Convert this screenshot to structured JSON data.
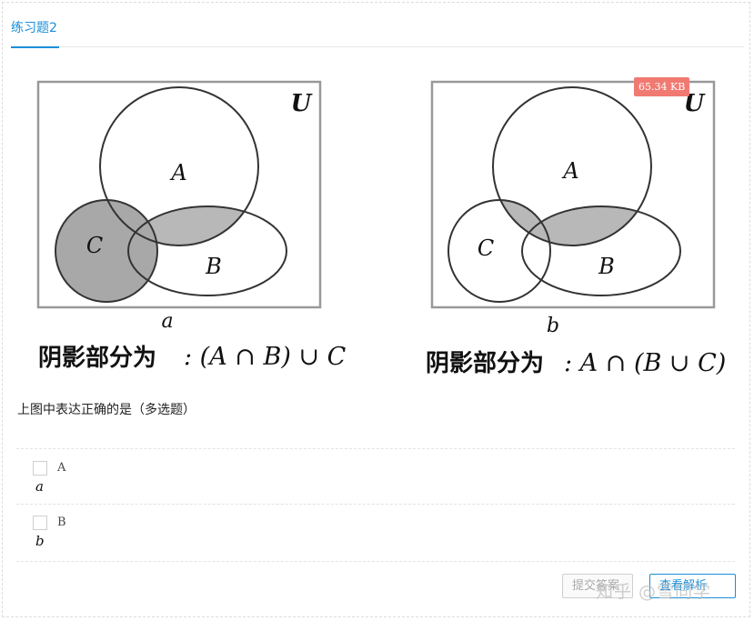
{
  "tab": {
    "label": "练习题2"
  },
  "diagram_a": {
    "universe_label": "U",
    "set_a": "A",
    "set_b": "B",
    "set_c": "C",
    "caption": "a",
    "formula_prefix": "阴影部分为",
    "formula": ": (A ∩ B) ∪ C"
  },
  "diagram_b": {
    "universe_label": "U",
    "set_a": "A",
    "set_b": "B",
    "set_c": "C",
    "caption": "b",
    "formula_prefix": "阴影部分为",
    "formula": ": A ∩ (B ∪ C)"
  },
  "size_badge": "65.34 KB",
  "question": "上图中表达正确的是（多选题）",
  "options": [
    {
      "letter": "A",
      "value": "a"
    },
    {
      "letter": "B",
      "value": "b"
    }
  ],
  "buttons": {
    "submit": "提交答案",
    "view_answer": "查看解析"
  },
  "watermark": "知乎 @雪同学",
  "colors": {
    "accent": "#1a8fd8",
    "shade": "#a8a8a8",
    "badge": "#f07a72"
  }
}
